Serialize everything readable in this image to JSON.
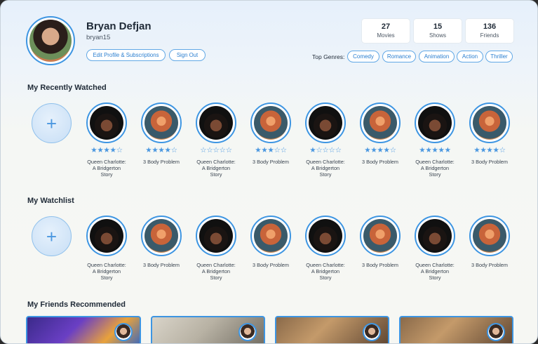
{
  "profile": {
    "name": "Bryan Defjan",
    "handle": "bryan15",
    "edit_label": "Edit Profile & Subscriptions",
    "signout_label": "Sign Out"
  },
  "stats": [
    {
      "value": "27",
      "label": "Movies"
    },
    {
      "value": "15",
      "label": "Shows"
    },
    {
      "value": "136",
      "label": "Friends"
    }
  ],
  "genres": {
    "label": "Top Genres:",
    "items": [
      "Comedy",
      "Romance",
      "Animation",
      "Action",
      "Thriller"
    ]
  },
  "recent": {
    "title": "My Recently Watched",
    "add_glyph": "+",
    "items": [
      {
        "title": "Queen Charlotte: A Bridgerton Story",
        "lines": [
          "Queen Charlotte:",
          "A Bridgerton",
          "Story"
        ],
        "rating": 4,
        "stars": "★★★★☆",
        "image": "queen-charlotte-poster"
      },
      {
        "title": "3 Body Problem",
        "lines": [
          "3 Body Problem"
        ],
        "rating": 4,
        "stars": "★★★★☆",
        "image": "3-body-problem-poster"
      },
      {
        "title": "Queen Charlotte: A Bridgerton Story",
        "lines": [
          "Queen Charlotte:",
          "A Bridgerton",
          "Story"
        ],
        "rating": 0,
        "stars": "☆☆☆☆☆",
        "image": "queen-charlotte-poster"
      },
      {
        "title": "3 Body Problem",
        "lines": [
          "3 Body Problem"
        ],
        "rating": 3,
        "stars": "★★★☆☆",
        "image": "3-body-problem-poster"
      },
      {
        "title": "Queen Charlotte: A Bridgerton Story",
        "lines": [
          "Queen Charlotte:",
          "A Bridgerton",
          "Story"
        ],
        "rating": 1,
        "stars": "★☆☆☆☆",
        "image": "queen-charlotte-poster"
      },
      {
        "title": "3 Body Problem",
        "lines": [
          "3 Body Problem"
        ],
        "rating": 4,
        "stars": "★★★★☆",
        "image": "3-body-problem-poster"
      },
      {
        "title": "Queen Charlotte: A Bridgerton Story",
        "lines": [
          "Queen Charlotte:",
          "A Bridgerton",
          "Story"
        ],
        "rating": 5,
        "stars": "★★★★★",
        "image": "queen-charlotte-poster"
      },
      {
        "title": "3 Body Problem",
        "lines": [
          "3 Body Problem"
        ],
        "rating": 4,
        "stars": "★★★★☆",
        "image": "3-body-problem-poster"
      }
    ]
  },
  "watchlist": {
    "title": "My Watchlist",
    "add_glyph": "+",
    "items": [
      {
        "title": "Queen Charlotte: A Bridgerton Story",
        "lines": [
          "Queen Charlotte:",
          "A Bridgerton",
          "Story"
        ],
        "image": "queen-charlotte-poster"
      },
      {
        "title": "3 Body Problem",
        "lines": [
          "3 Body Problem"
        ],
        "image": "3-body-problem-poster"
      },
      {
        "title": "Queen Charlotte: A Bridgerton Story",
        "lines": [
          "Queen Charlotte:",
          "A Bridgerton",
          "Story"
        ],
        "image": "queen-charlotte-poster"
      },
      {
        "title": "3 Body Problem",
        "lines": [
          "3 Body Problem"
        ],
        "image": "3-body-problem-poster"
      },
      {
        "title": "Queen Charlotte: A Bridgerton Story",
        "lines": [
          "Queen Charlotte:",
          "A Bridgerton",
          "Story"
        ],
        "image": "queen-charlotte-poster"
      },
      {
        "title": "3 Body Problem",
        "lines": [
          "3 Body Problem"
        ],
        "image": "3-body-problem-poster"
      },
      {
        "title": "Queen Charlotte: A Bridgerton Story",
        "lines": [
          "Queen Charlotte:",
          "A Bridgerton",
          "Story"
        ],
        "image": "queen-charlotte-poster"
      },
      {
        "title": "3 Body Problem",
        "lines": [
          "3 Body Problem"
        ],
        "image": "3-body-problem-poster"
      }
    ]
  },
  "friends": {
    "title": "My Friends Recommended",
    "cards": [
      {
        "image": "animated-movie-still",
        "friend_avatar": "friend-avatar"
      },
      {
        "image": "live-action-still",
        "friend_avatar": "friend-avatar"
      },
      {
        "image": "period-drama-still",
        "friend_avatar": "friend-avatar"
      },
      {
        "image": "period-drama-still",
        "friend_avatar": "friend-avatar"
      }
    ]
  },
  "colors": {
    "accent": "#3d95e2",
    "star": "#4a97e0",
    "text": "#1f2a37"
  }
}
